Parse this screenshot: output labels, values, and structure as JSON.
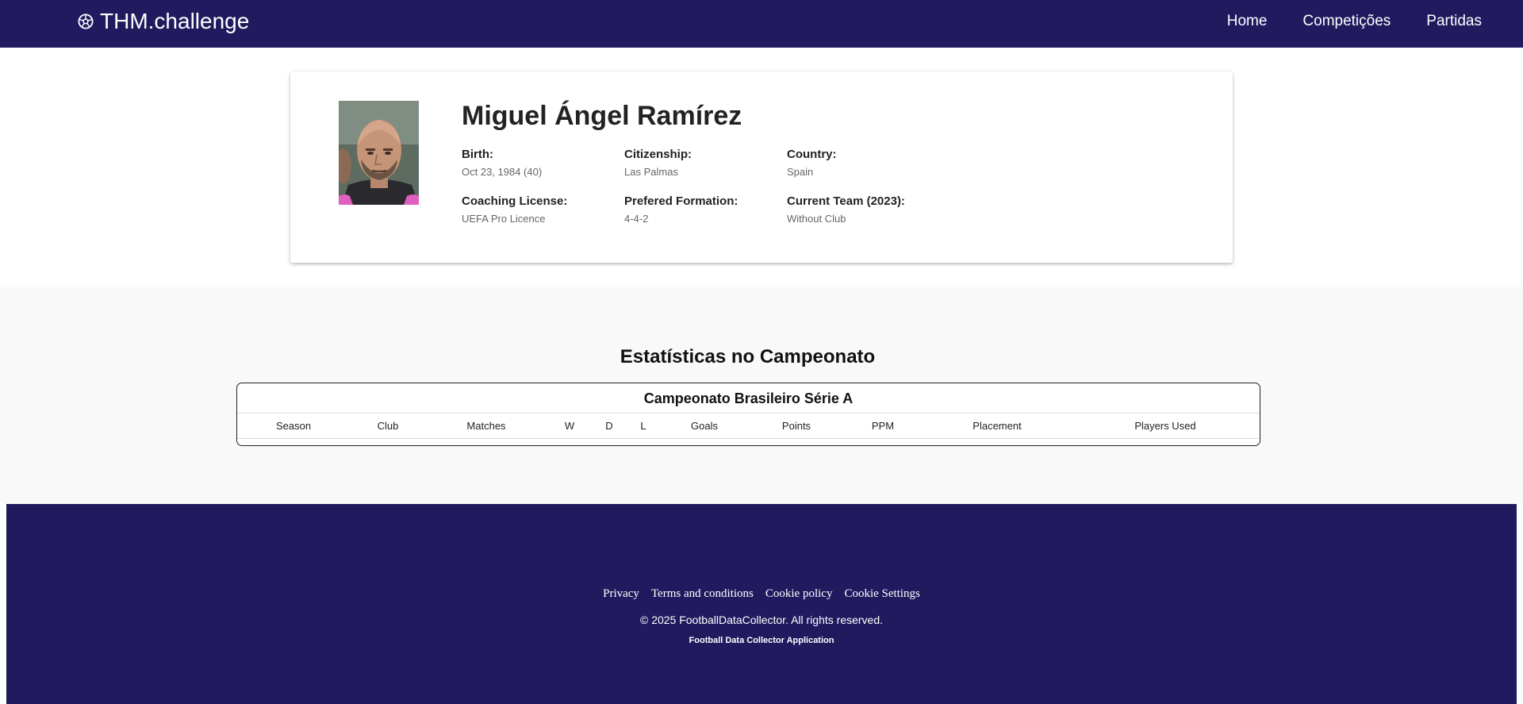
{
  "nav": {
    "brand": "THM.challenge",
    "brand_icon": "soccer-ball-icon",
    "links": [
      "Home",
      "Competições",
      "Partidas"
    ]
  },
  "coach": {
    "name": "Miguel Ángel Ramírez",
    "fields": [
      {
        "label": "Birth:",
        "value": "Oct 23, 1984 (40)"
      },
      {
        "label": "Citizenship:",
        "value": "Las Palmas"
      },
      {
        "label": "Country:",
        "value": "Spain"
      },
      {
        "label": "Coaching License:",
        "value": "UEFA Pro Licence"
      },
      {
        "label": "Prefered Formation:",
        "value": "4-4-2"
      },
      {
        "label": "Current Team (2023):",
        "value": "Without Club"
      }
    ]
  },
  "stats": {
    "title": "Estatísticas no Campeonato",
    "league": "Campeonato Brasileiro Série A",
    "columns": [
      "Season",
      "Club",
      "Matches",
      "W",
      "D",
      "L",
      "Goals",
      "Points",
      "PPM",
      "Placement",
      "Players Used"
    ],
    "rows": []
  },
  "footer": {
    "links": [
      "Privacy",
      "Terms and conditions",
      "Cookie policy",
      "Cookie Settings"
    ],
    "copyright": "© 2025 FootballDataCollector. All rights reserved.",
    "app_name": "Football Data Collector Application"
  },
  "colors": {
    "navbar": "#211a5f",
    "footer": "#211a5f",
    "stats_background": "#f9f9f9"
  }
}
